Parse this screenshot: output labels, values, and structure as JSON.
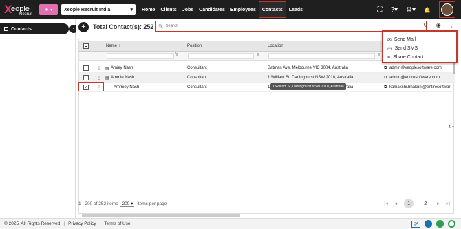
{
  "logo": {
    "x": "X",
    "eople": "eople",
    "recruit": "Recruit"
  },
  "add_button": {
    "plus": "+",
    "caret": "▾"
  },
  "company": {
    "value": "Xeople Recruit India",
    "caret": "▾"
  },
  "nav": [
    "Home",
    "Clients",
    "Jobs",
    "Candidates",
    "Employees",
    "Contacts",
    "Leads"
  ],
  "top_icons": {
    "fullscreen": "⛶",
    "help": "?▾",
    "settings": "⚙▾",
    "bell": "🔔"
  },
  "sidebar": {
    "contacts_label": "Contacts",
    "collapse": "‹"
  },
  "main": {
    "add_symbol": "+",
    "total_label": "Total Contact(s): 252"
  },
  "search": {
    "placeholder": "Search",
    "icon": "🔍"
  },
  "toolbar_icons": {
    "refresh": "↻",
    "target": "◉",
    "more": "⋮"
  },
  "menu": {
    "items": [
      "Send Mail",
      "Send SMS",
      "Share Contact"
    ],
    "icons": [
      "✉",
      "▭",
      "≡"
    ]
  },
  "grid": {
    "headers": {
      "name": "Name ↑",
      "position": "Position",
      "location": "Location"
    },
    "filter_icon": "Y",
    "rows": [
      {
        "name": "Amiey Nash",
        "position": "Consultant",
        "location": "Batman Ave, Melbourne VIC 3004, Australia",
        "email": "admin@xeoplesoftware.com",
        "checked": "",
        "menu": "⋮",
        "card": "▤"
      },
      {
        "name": "Ammie Nash",
        "position": "Consultant",
        "location": "1 William St, Darlinghurst NSW 2010, Australia",
        "email": "admin@entiresoftware.com",
        "checked": "",
        "menu": "⋮",
        "card": "▤"
      },
      {
        "name": "Ammiey Nash",
        "position": "Consultant",
        "location": "1 William St, Darlinghurst NSW 2010, Australia",
        "email": "kamakshi.bhakuni@entiresoftwar",
        "checked": "✓",
        "menu": "⋮",
        "card": ""
      }
    ],
    "email_icon": "⧉",
    "tooltip": "1 William St, Darlinghurst NSW 2010, Australia",
    "partial_right": "t⋯"
  },
  "pager": {
    "range": "1 - 200 of 252 items",
    "page_size": "200",
    "page_size_caret": "▾",
    "items_per_page": "items per page",
    "first": "|◂",
    "prev": "◂",
    "pages": [
      "1",
      "2"
    ],
    "next": "▸",
    "last": "▸|"
  },
  "footer": {
    "copyright": "© 2025. All Rights Reserved",
    "sep": "|",
    "privacy": "Privacy Policy",
    "terms": "Terms of Use",
    "qa": "QA"
  },
  "colors": {
    "topbar": "#1f1f1f",
    "accent_red": "#c0392b",
    "add_pink": "#e26fb0",
    "logo_pink": "#e23b6d"
  }
}
